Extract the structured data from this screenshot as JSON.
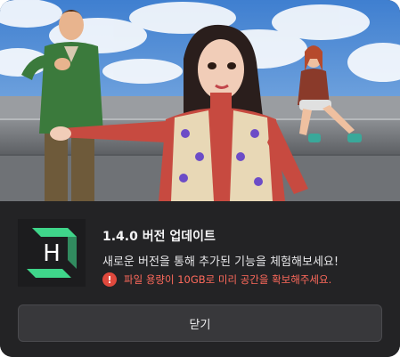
{
  "dialog": {
    "title": "1.4.0 버전 업데이트",
    "description": "새로운 버전을 통해 추가된 기능을 체험해보세요!",
    "warning_icon": "exclamation-icon",
    "warning_text": "파일 용량이 10GB로 미리 공간을 확보해주세요.",
    "close_label": "닫기",
    "app_icon_letter": "H"
  },
  "colors": {
    "panel_background": "#232325",
    "button_background": "#38383b",
    "warning": "#e0493d",
    "brand_green": "#3fd58a"
  }
}
